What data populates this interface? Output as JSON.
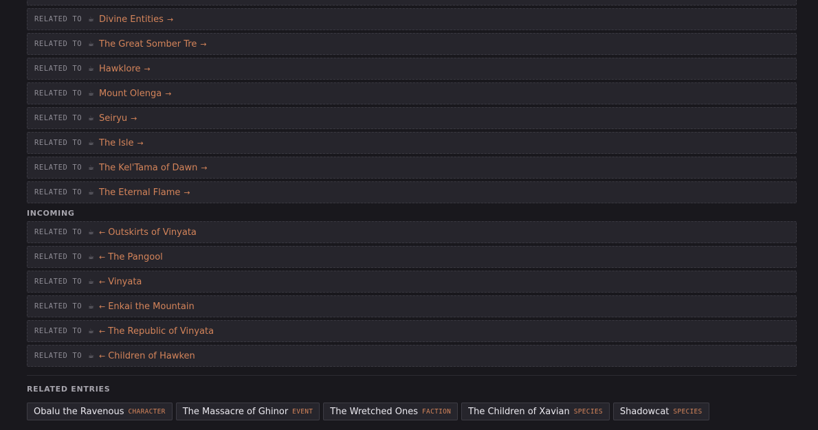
{
  "outgoing": [
    {
      "relation": "RELATED TO",
      "name": "Divine Entities"
    },
    {
      "relation": "RELATED TO",
      "name": "The Great Somber Tre"
    },
    {
      "relation": "RELATED TO",
      "name": "Hawklore"
    },
    {
      "relation": "RELATED TO",
      "name": "Mount Olenga"
    },
    {
      "relation": "RELATED TO",
      "name": "Seiryu"
    },
    {
      "relation": "RELATED TO",
      "name": "The Isle"
    },
    {
      "relation": "RELATED TO",
      "name": "The Kel'Tama of Dawn"
    },
    {
      "relation": "RELATED TO",
      "name": "The Eternal Flame"
    }
  ],
  "incoming_label": "INCOMING",
  "incoming": [
    {
      "relation": "RELATED TO",
      "name": "Outskirts of Vinyata"
    },
    {
      "relation": "RELATED TO",
      "name": "The Pangool"
    },
    {
      "relation": "RELATED TO",
      "name": "Vinyata"
    },
    {
      "relation": "RELATED TO",
      "name": "Enkai the Mountain"
    },
    {
      "relation": "RELATED TO",
      "name": "The Republic of Vinyata"
    },
    {
      "relation": "RELATED TO",
      "name": "Children of Hawken"
    }
  ],
  "related_entries_label": "RELATED ENTRIES",
  "related_entries": [
    {
      "name": "Obalu the Ravenous",
      "type": "CHARACTER"
    },
    {
      "name": "The Massacre of Ghinor",
      "type": "EVENT"
    },
    {
      "name": "The Wretched Ones",
      "type": "FACTION"
    },
    {
      "name": "The Children of Xavian",
      "type": "SPECIES"
    },
    {
      "name": "Shadowcat",
      "type": "SPECIES"
    }
  ],
  "icons": {
    "relation": "cup-icon",
    "out": "arrow-right-icon",
    "in": "arrow-left-icon"
  },
  "colors": {
    "accent": "#d4845a",
    "background": "#19181d",
    "row": "#26252c"
  }
}
